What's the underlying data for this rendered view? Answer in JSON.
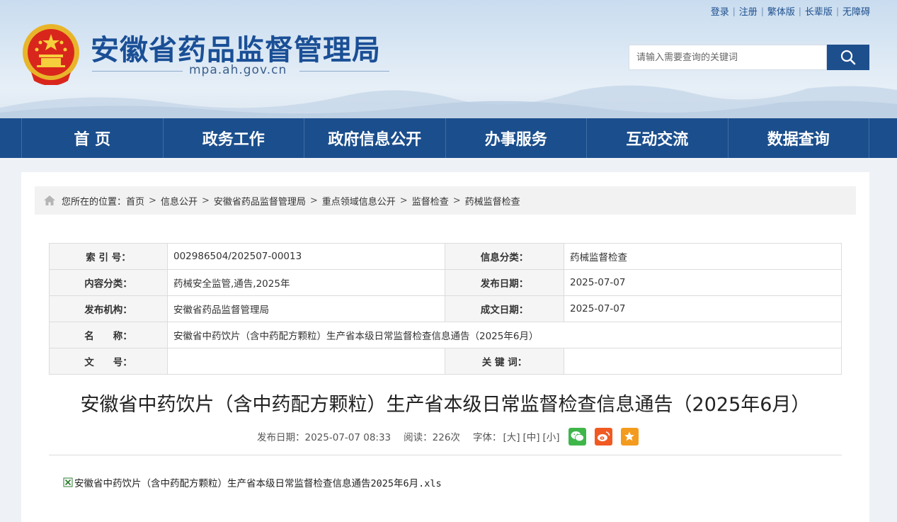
{
  "top_links": [
    "登录",
    "注册",
    "繁体版",
    "长辈版",
    "无障碍"
  ],
  "site": {
    "title": "安徽省药品监督管理局",
    "domain": "mpa.ah.gov.cn"
  },
  "search": {
    "placeholder": "请输入需要查询的关键词"
  },
  "nav": [
    "首 页",
    "政务工作",
    "政府信息公开",
    "办事服务",
    "互动交流",
    "数据查询"
  ],
  "breadcrumb": {
    "prefix": "您所在的位置：",
    "items": [
      "首页",
      "信息公开",
      "安徽省药品监督管理局",
      "重点领域信息公开",
      "监督检查",
      "药械监督检查"
    ]
  },
  "meta": {
    "index_label": "索 引 号：",
    "index_value": "002986504/202507-00013",
    "category_label": "信息分类：",
    "category_value": "药械监督检查",
    "content_label": "内容分类：",
    "content_value": "药械安全监管,通告,2025年",
    "pubdate_label": "发布日期：",
    "pubdate_value": "2025-07-07",
    "org_label": "发布机构：",
    "org_value": "安徽省药品监督管理局",
    "made_label": "成文日期：",
    "made_value": "2025-07-07",
    "name_label": "名　　称：",
    "name_value": "安徽省中药饮片（含中药配方颗粒）生产省本级日常监督检查信息通告（2025年6月）",
    "docno_label": "文　　号：",
    "docno_value": "",
    "keyword_label": "关 键 词：",
    "keyword_value": ""
  },
  "article": {
    "title": "安徽省中药饮片（含中药配方颗粒）生产省本级日常监督检查信息通告（2025年6月）",
    "date": "发布日期：2025-07-07 08:33",
    "reads": "阅读：226次",
    "font_label": "字体：",
    "font_large": "[大]",
    "font_mid": "[中]",
    "font_small": "[小]",
    "attachment": "安徽省中药饮片（含中药配方颗粒）生产省本级日常监督检查信息通告2025年6月.xls"
  },
  "colors": {
    "brand": "#1b4e8c",
    "wechat": "#3fb64a",
    "weibo": "#f05a22",
    "fav": "#f39b1e"
  }
}
